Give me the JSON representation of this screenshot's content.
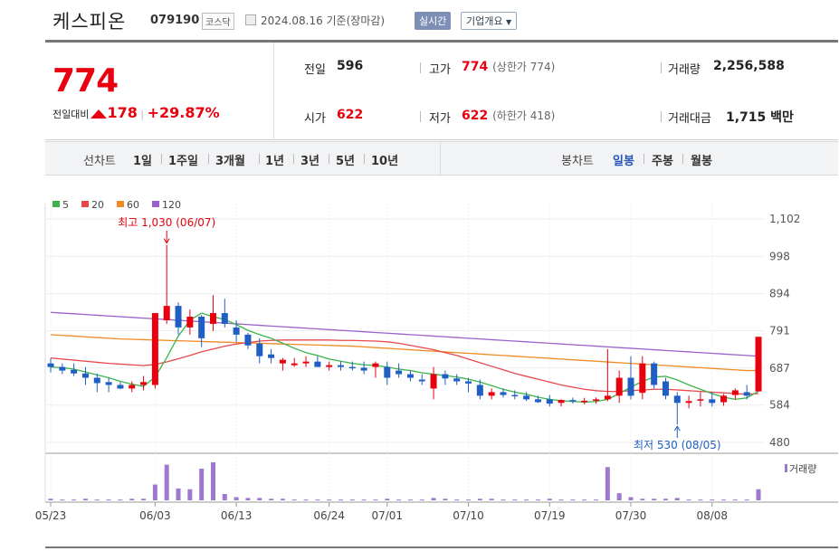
{
  "header": {
    "name": "케스피온",
    "code": "079190",
    "market": "코스닥",
    "date": "2024.08.16 기준(장마감)",
    "realtime": "실시간",
    "company_btn": "기업개요"
  },
  "price": {
    "current": "774",
    "change_label": "전일대비",
    "change": "178",
    "change_pct": "+29.87%"
  },
  "stats": {
    "prev_label": "전일",
    "prev": "596",
    "high_label": "고가",
    "high": "774",
    "high_note": "(상한가 774)",
    "volume_label": "거래량",
    "volume": "2,256,588",
    "open_label": "시가",
    "open": "622",
    "low_label": "저가",
    "low": "622",
    "low_note": "(하한가 418)",
    "amount_label": "거래대금",
    "amount": "1,715 백만"
  },
  "periods": {
    "line_label": "선차트",
    "items": [
      "1일",
      "1주일",
      "3개월",
      "1년",
      "3년",
      "5년",
      "10년"
    ],
    "candle_label": "봉차트",
    "candle_items": [
      "일봉",
      "주봉",
      "월봉"
    ],
    "candle_selected": "일봉"
  },
  "chart_data": {
    "type": "candlestick",
    "legend": [
      {
        "name": "5",
        "color": "#3cb44b"
      },
      {
        "name": "20",
        "color": "#e8484a"
      },
      {
        "name": "60",
        "color": "#f08a24"
      },
      {
        "name": "120",
        "color": "#9a63c9"
      }
    ],
    "y_ticks": [
      1102,
      998,
      894,
      791,
      687,
      584,
      480
    ],
    "ylim": [
      480,
      1102
    ],
    "x_labels": [
      {
        "i": 0,
        "t": "05/23"
      },
      {
        "i": 9,
        "t": "06/03"
      },
      {
        "i": 16,
        "t": "06/13"
      },
      {
        "i": 24,
        "t": "06/24"
      },
      {
        "i": 29,
        "t": "07/01"
      },
      {
        "i": 36,
        "t": "07/10"
      },
      {
        "i": 43,
        "t": "07/19"
      },
      {
        "i": 50,
        "t": "07/30"
      },
      {
        "i": 57,
        "t": "08/08"
      }
    ],
    "high_note": "최고 1,030 (06/07)",
    "high_index": 10,
    "high_value": 1030,
    "low_note": "최저 530 (08/05)",
    "low_index": 54,
    "low_value": 530,
    "volume_label": "거래량",
    "candles": [
      [
        700,
        714,
        675,
        690
      ],
      [
        690,
        700,
        670,
        680
      ],
      [
        682,
        700,
        665,
        672
      ],
      [
        672,
        690,
        640,
        660
      ],
      [
        660,
        672,
        620,
        645
      ],
      [
        648,
        660,
        620,
        640
      ],
      [
        640,
        648,
        628,
        630
      ],
      [
        630,
        650,
        620,
        640
      ],
      [
        640,
        665,
        625,
        648
      ],
      [
        640,
        840,
        630,
        840
      ],
      [
        820,
        1030,
        810,
        860
      ],
      [
        860,
        870,
        780,
        800
      ],
      [
        800,
        850,
        780,
        830
      ],
      [
        830,
        835,
        745,
        770
      ],
      [
        810,
        890,
        790,
        840
      ],
      [
        840,
        880,
        800,
        810
      ],
      [
        800,
        820,
        760,
        780
      ],
      [
        780,
        785,
        740,
        750
      ],
      [
        755,
        770,
        700,
        720
      ],
      [
        725,
        740,
        700,
        715
      ],
      [
        700,
        715,
        680,
        710
      ],
      [
        695,
        715,
        690,
        700
      ],
      [
        700,
        720,
        690,
        705
      ],
      [
        705,
        720,
        690,
        690
      ],
      [
        690,
        705,
        680,
        695
      ],
      [
        695,
        705,
        680,
        690
      ],
      [
        690,
        705,
        680,
        688
      ],
      [
        688,
        705,
        670,
        680
      ],
      [
        690,
        705,
        660,
        700
      ],
      [
        690,
        705,
        640,
        660
      ],
      [
        680,
        700,
        660,
        670
      ],
      [
        670,
        680,
        650,
        660
      ],
      [
        655,
        670,
        640,
        650
      ],
      [
        630,
        690,
        600,
        670
      ],
      [
        670,
        680,
        640,
        658
      ],
      [
        658,
        670,
        640,
        650
      ],
      [
        650,
        660,
        620,
        644
      ],
      [
        640,
        655,
        600,
        610
      ],
      [
        610,
        630,
        600,
        620
      ],
      [
        620,
        630,
        605,
        612
      ],
      [
        612,
        625,
        600,
        610
      ],
      [
        610,
        620,
        595,
        600
      ],
      [
        600,
        610,
        590,
        592
      ],
      [
        600,
        612,
        580,
        588
      ],
      [
        590,
        600,
        580,
        598
      ],
      [
        598,
        605,
        588,
        594
      ],
      [
        594,
        604,
        586,
        596
      ],
      [
        596,
        605,
        588,
        600
      ],
      [
        600,
        740,
        595,
        610
      ],
      [
        610,
        680,
        590,
        660
      ],
      [
        660,
        720,
        600,
        610
      ],
      [
        618,
        720,
        600,
        700
      ],
      [
        700,
        705,
        630,
        640
      ],
      [
        650,
        660,
        600,
        610
      ],
      [
        610,
        620,
        530,
        590
      ],
      [
        590,
        610,
        575,
        595
      ],
      [
        597,
        620,
        580,
        600
      ],
      [
        600,
        620,
        580,
        590
      ],
      [
        592,
        615,
        582,
        610
      ],
      [
        612,
        630,
        600,
        625
      ],
      [
        620,
        640,
        600,
        610
      ],
      [
        622,
        774,
        622,
        774
      ]
    ],
    "volumes": [
      2,
      1,
      1,
      2,
      1,
      1,
      1,
      2,
      2,
      20,
      45,
      15,
      14,
      40,
      48,
      8,
      4,
      3,
      3,
      2,
      2,
      1,
      1,
      1,
      1,
      1,
      1,
      1,
      1,
      2,
      1,
      1,
      1,
      3,
      2,
      1,
      1,
      2,
      2,
      1,
      1,
      1,
      1,
      2,
      1,
      1,
      1,
      1,
      42,
      9,
      4,
      2,
      2,
      2,
      3,
      1,
      1,
      1,
      1,
      1,
      1,
      14
    ],
    "ma5": [
      690,
      688,
      684,
      676,
      668,
      660,
      650,
      642,
      636,
      662,
      716,
      776,
      820,
      840,
      830,
      822,
      808,
      792,
      780,
      770,
      756,
      742,
      730,
      722,
      712,
      706,
      700,
      696,
      694,
      690,
      684,
      680,
      674,
      670,
      666,
      662,
      656,
      648,
      638,
      628,
      620,
      614,
      606,
      600,
      596,
      594,
      592,
      594,
      600,
      616,
      634,
      650,
      662,
      664,
      654,
      640,
      628,
      616,
      606,
      600,
      604,
      622
    ],
    "ma20": [
      715,
      712,
      709,
      706,
      703,
      700,
      698,
      696,
      694,
      697,
      704,
      713,
      722,
      732,
      740,
      748,
      754,
      758,
      762,
      764,
      765,
      765,
      765,
      765,
      765,
      764,
      764,
      763,
      762,
      760,
      756,
      750,
      744,
      738,
      730,
      722,
      712,
      702,
      692,
      682,
      672,
      664,
      656,
      648,
      640,
      634,
      628,
      624,
      622,
      622,
      624,
      626,
      628,
      628,
      626,
      624,
      622,
      620,
      618,
      616,
      614,
      616
    ],
    "ma60": [
      780,
      778,
      776,
      774,
      772,
      770,
      768,
      767,
      766,
      765,
      764,
      763,
      762,
      761,
      760,
      759,
      758,
      757,
      756,
      755,
      754,
      753,
      752,
      751,
      750,
      749,
      748,
      746,
      744,
      742,
      740,
      738,
      736,
      734,
      732,
      730,
      728,
      726,
      724,
      722,
      720,
      718,
      716,
      714,
      712,
      710,
      708,
      706,
      704,
      702,
      700,
      698,
      696,
      694,
      692,
      690,
      688,
      686,
      684,
      682,
      680,
      680
    ],
    "ma120": [
      842,
      840,
      838,
      836,
      834,
      832,
      830,
      828,
      826,
      824,
      822,
      820,
      818,
      816,
      814,
      812,
      810,
      808,
      806,
      804,
      802,
      800,
      798,
      796,
      794,
      792,
      790,
      788,
      786,
      784,
      782,
      780,
      778,
      776,
      774,
      772,
      770,
      768,
      766,
      764,
      762,
      760,
      758,
      756,
      754,
      752,
      750,
      748,
      746,
      744,
      742,
      740,
      738,
      736,
      734,
      732,
      730,
      728,
      726,
      724,
      722,
      720
    ]
  }
}
